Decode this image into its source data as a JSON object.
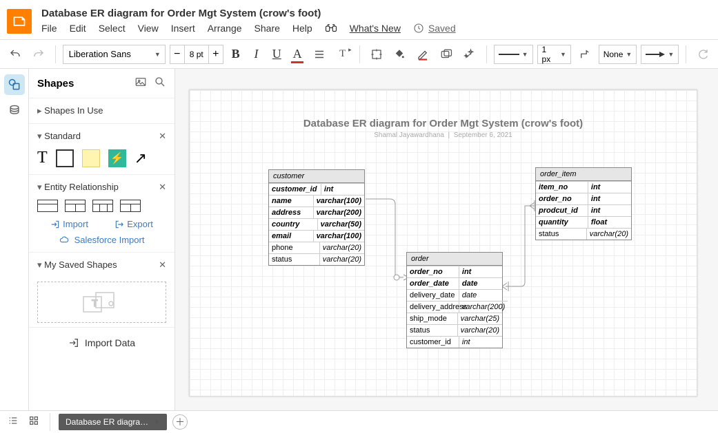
{
  "doc": {
    "title": "Database ER diagram for Order  Mgt System (crow's foot)"
  },
  "menu": [
    "File",
    "Edit",
    "Select",
    "View",
    "Insert",
    "Arrange",
    "Share",
    "Help"
  ],
  "whats_new": "What's New",
  "saved": "Saved",
  "toolbar": {
    "font": "Liberation Sans",
    "size": "8 pt",
    "line_width": "1 px",
    "fill": "None"
  },
  "sidebar": {
    "title": "Shapes",
    "shapes_in_use": "Shapes In Use",
    "standard": "Standard",
    "er": "Entity Relationship",
    "import": "Import",
    "export": "Export",
    "salesforce": "Salesforce Import",
    "my_saved": "My Saved Shapes",
    "import_data": "Import Data"
  },
  "diagram": {
    "title": "Database ER diagram for Order  Mgt System (crow's foot)",
    "author": "Shamal Jayawardhana",
    "date": "September 6, 2021",
    "entities": {
      "customer": {
        "name": "customer",
        "fields": [
          [
            "customer_id",
            "int",
            true
          ],
          [
            "name",
            "varchar(100)",
            true
          ],
          [
            "address",
            "varchar(200)",
            true
          ],
          [
            "country",
            "varchar(50)",
            true
          ],
          [
            "email",
            "varchar(100)",
            true
          ],
          [
            "phone",
            "varchar(20)",
            false
          ],
          [
            "status",
            "varchar(20)",
            false
          ]
        ]
      },
      "order": {
        "name": "order",
        "fields": [
          [
            "order_no",
            "int",
            true
          ],
          [
            "order_date",
            "date",
            true
          ],
          [
            "delivery_date",
            "date",
            false
          ],
          [
            "delivery_address",
            "varchar(200)",
            false
          ],
          [
            "ship_mode",
            "varchar(25)",
            false
          ],
          [
            "status",
            "varchar(20)",
            false
          ],
          [
            "customer_id",
            "int",
            false
          ]
        ]
      },
      "order_item": {
        "name": "order_item",
        "fields": [
          [
            "item_no",
            "int",
            true
          ],
          [
            "order_no",
            "int",
            true
          ],
          [
            "prodcut_id",
            "int",
            true
          ],
          [
            "quantity",
            "float",
            true
          ],
          [
            "status",
            "varchar(20)",
            false
          ]
        ]
      }
    }
  },
  "footer": {
    "tab": "Database ER diagra…"
  }
}
